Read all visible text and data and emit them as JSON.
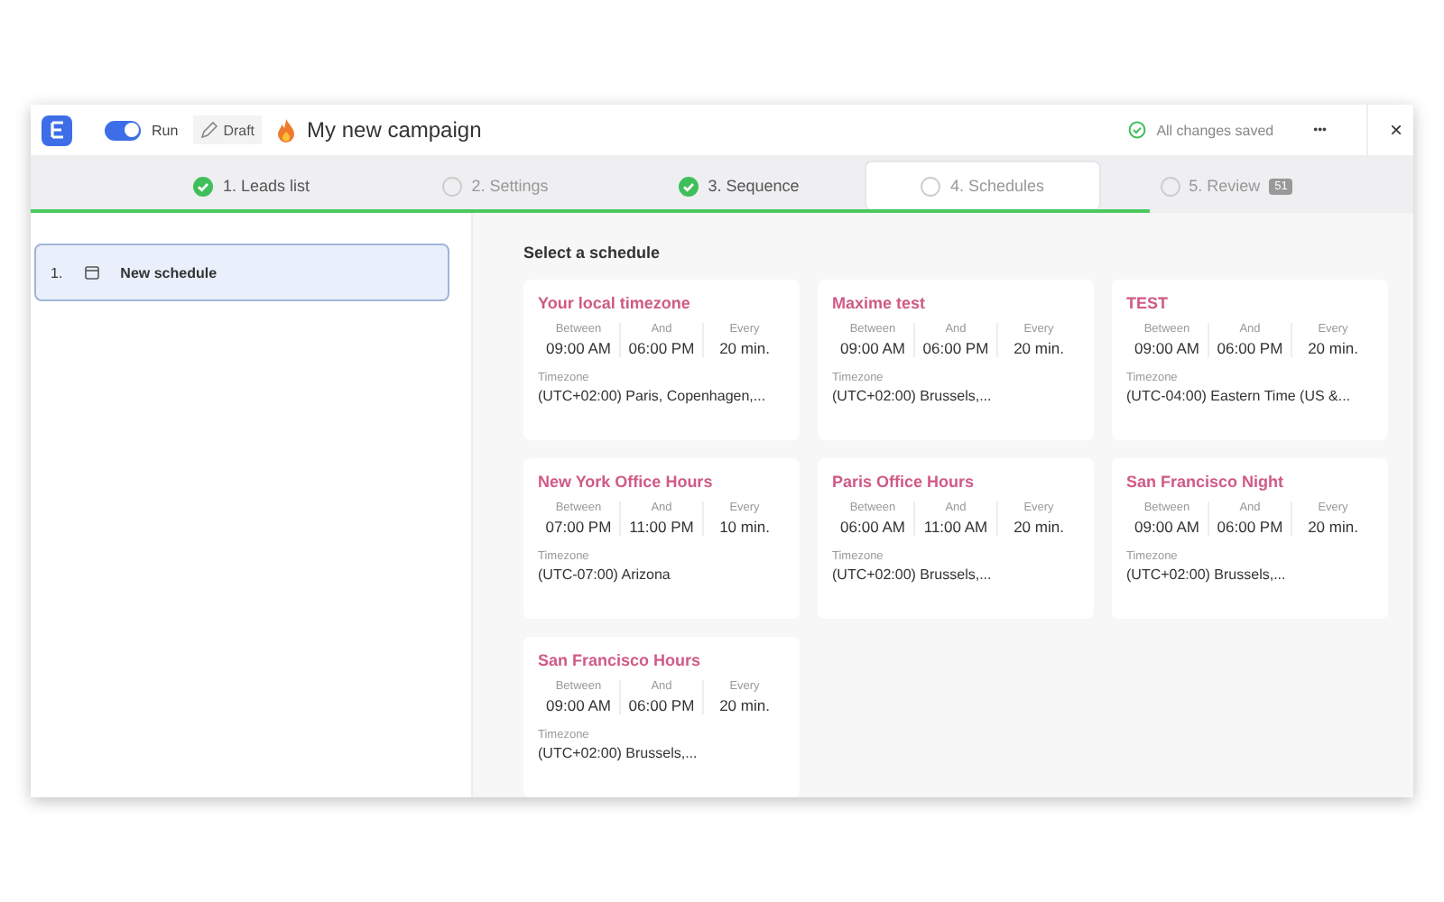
{
  "header": {
    "run_toggle": {
      "on": true,
      "label": "Run"
    },
    "draft_button": "Draft",
    "title": "My new campaign",
    "saved_status": "All changes saved",
    "more_button": "•••",
    "close_button": "×"
  },
  "steps": [
    {
      "label": "1.  Leads list",
      "done": true,
      "selected": false
    },
    {
      "label": "2.  Settings",
      "done": false,
      "selected": false
    },
    {
      "label": "3.  Sequence",
      "done": true,
      "selected": false
    },
    {
      "label": "4.  Schedules",
      "done": false,
      "selected": true
    },
    {
      "label": "5.  Review",
      "done": false,
      "selected": false,
      "badge": "51"
    }
  ],
  "progress": {
    "level": 0.81
  },
  "sidebar": {
    "items": [
      {
        "number": "1.",
        "label": "New schedule",
        "selected": true
      }
    ]
  },
  "main": {
    "heading": "Select a schedule",
    "schedules": [
      {
        "name": "Your local timezone",
        "between_label": "Between",
        "between": "09:00 AM",
        "and_label": "And",
        "and": "06:00 PM",
        "every_label": "Every",
        "every": "20 min.",
        "timezone_label": "Timezone",
        "timezone": "(UTC+02:00) Paris,  Copenhagen,..."
      },
      {
        "name": "Maxime test",
        "between_label": "Between",
        "between": "09:00 AM",
        "and_label": "And",
        "and": "06:00 PM",
        "every_label": "Every",
        "every": "20 min.",
        "timezone_label": "Timezone",
        "timezone": "(UTC+02:00) Brussels,..."
      },
      {
        "name": "TEST",
        "between_label": "Between",
        "between": "09:00 AM",
        "and_label": "And",
        "and": "06:00 PM",
        "every_label": "Every",
        "every": "20 min.",
        "timezone_label": "Timezone",
        "timezone": "(UTC-04:00) Eastern Time (US &..."
      },
      {
        "name": "New York Office Hours",
        "between_label": "Between",
        "between": "07:00 PM",
        "and_label": "And",
        "and": "11:00 PM",
        "every_label": "Every",
        "every": "10 min.",
        "timezone_label": "Timezone",
        "timezone": "(UTC-07:00) Arizona"
      },
      {
        "name": "Paris Office Hours",
        "between_label": "Between",
        "between": "06:00 AM",
        "and_label": "And",
        "and": "11:00 AM",
        "every_label": "Every",
        "every": "20 min.",
        "timezone_label": "Timezone",
        "timezone": "(UTC+02:00) Brussels,..."
      },
      {
        "name": "San Francisco Night",
        "between_label": "Between",
        "between": "09:00 AM",
        "and_label": "And",
        "and": "06:00 PM",
        "every_label": "Every",
        "every": "20 min.",
        "timezone_label": "Timezone",
        "timezone": "(UTC+02:00) Brussels,..."
      },
      {
        "name": "San Francisco Hours",
        "between_label": "Between",
        "between": "09:00 AM",
        "and_label": "And",
        "and": "06:00 PM",
        "every_label": "Every",
        "every": "20 min.",
        "timezone_label": "Timezone",
        "timezone": "(UTC+02:00) Brussels,..."
      }
    ]
  }
}
